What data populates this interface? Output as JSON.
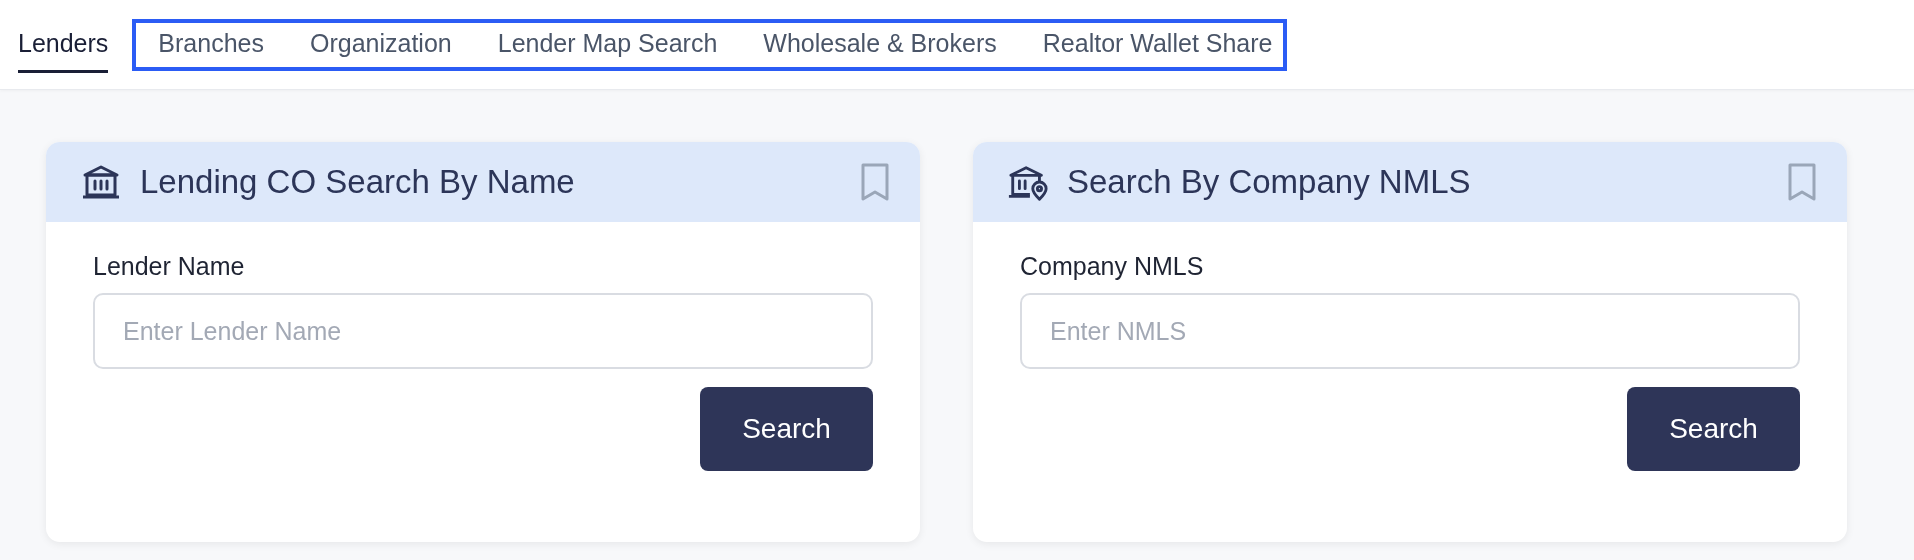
{
  "tabs": [
    {
      "label": "Lenders",
      "selected": true,
      "highlighted": false
    },
    {
      "label": "Branches",
      "selected": false,
      "highlighted": true
    },
    {
      "label": "Organization",
      "selected": false,
      "highlighted": true
    },
    {
      "label": "Lender Map Search",
      "selected": false,
      "highlighted": true
    },
    {
      "label": "Wholesale & Brokers",
      "selected": false,
      "highlighted": true
    },
    {
      "label": "Realtor Wallet Share",
      "selected": false,
      "highlighted": true
    }
  ],
  "cards": [
    {
      "title": "Lending CO Search By Name",
      "kind": "bank",
      "field_label": "Lender Name",
      "placeholder": "Enter Lender Name",
      "button": "Search"
    },
    {
      "title": "Search By Company NMLS",
      "kind": "bank-pin",
      "field_label": "Company NMLS",
      "placeholder": "Enter NMLS",
      "button": "Search"
    }
  ]
}
